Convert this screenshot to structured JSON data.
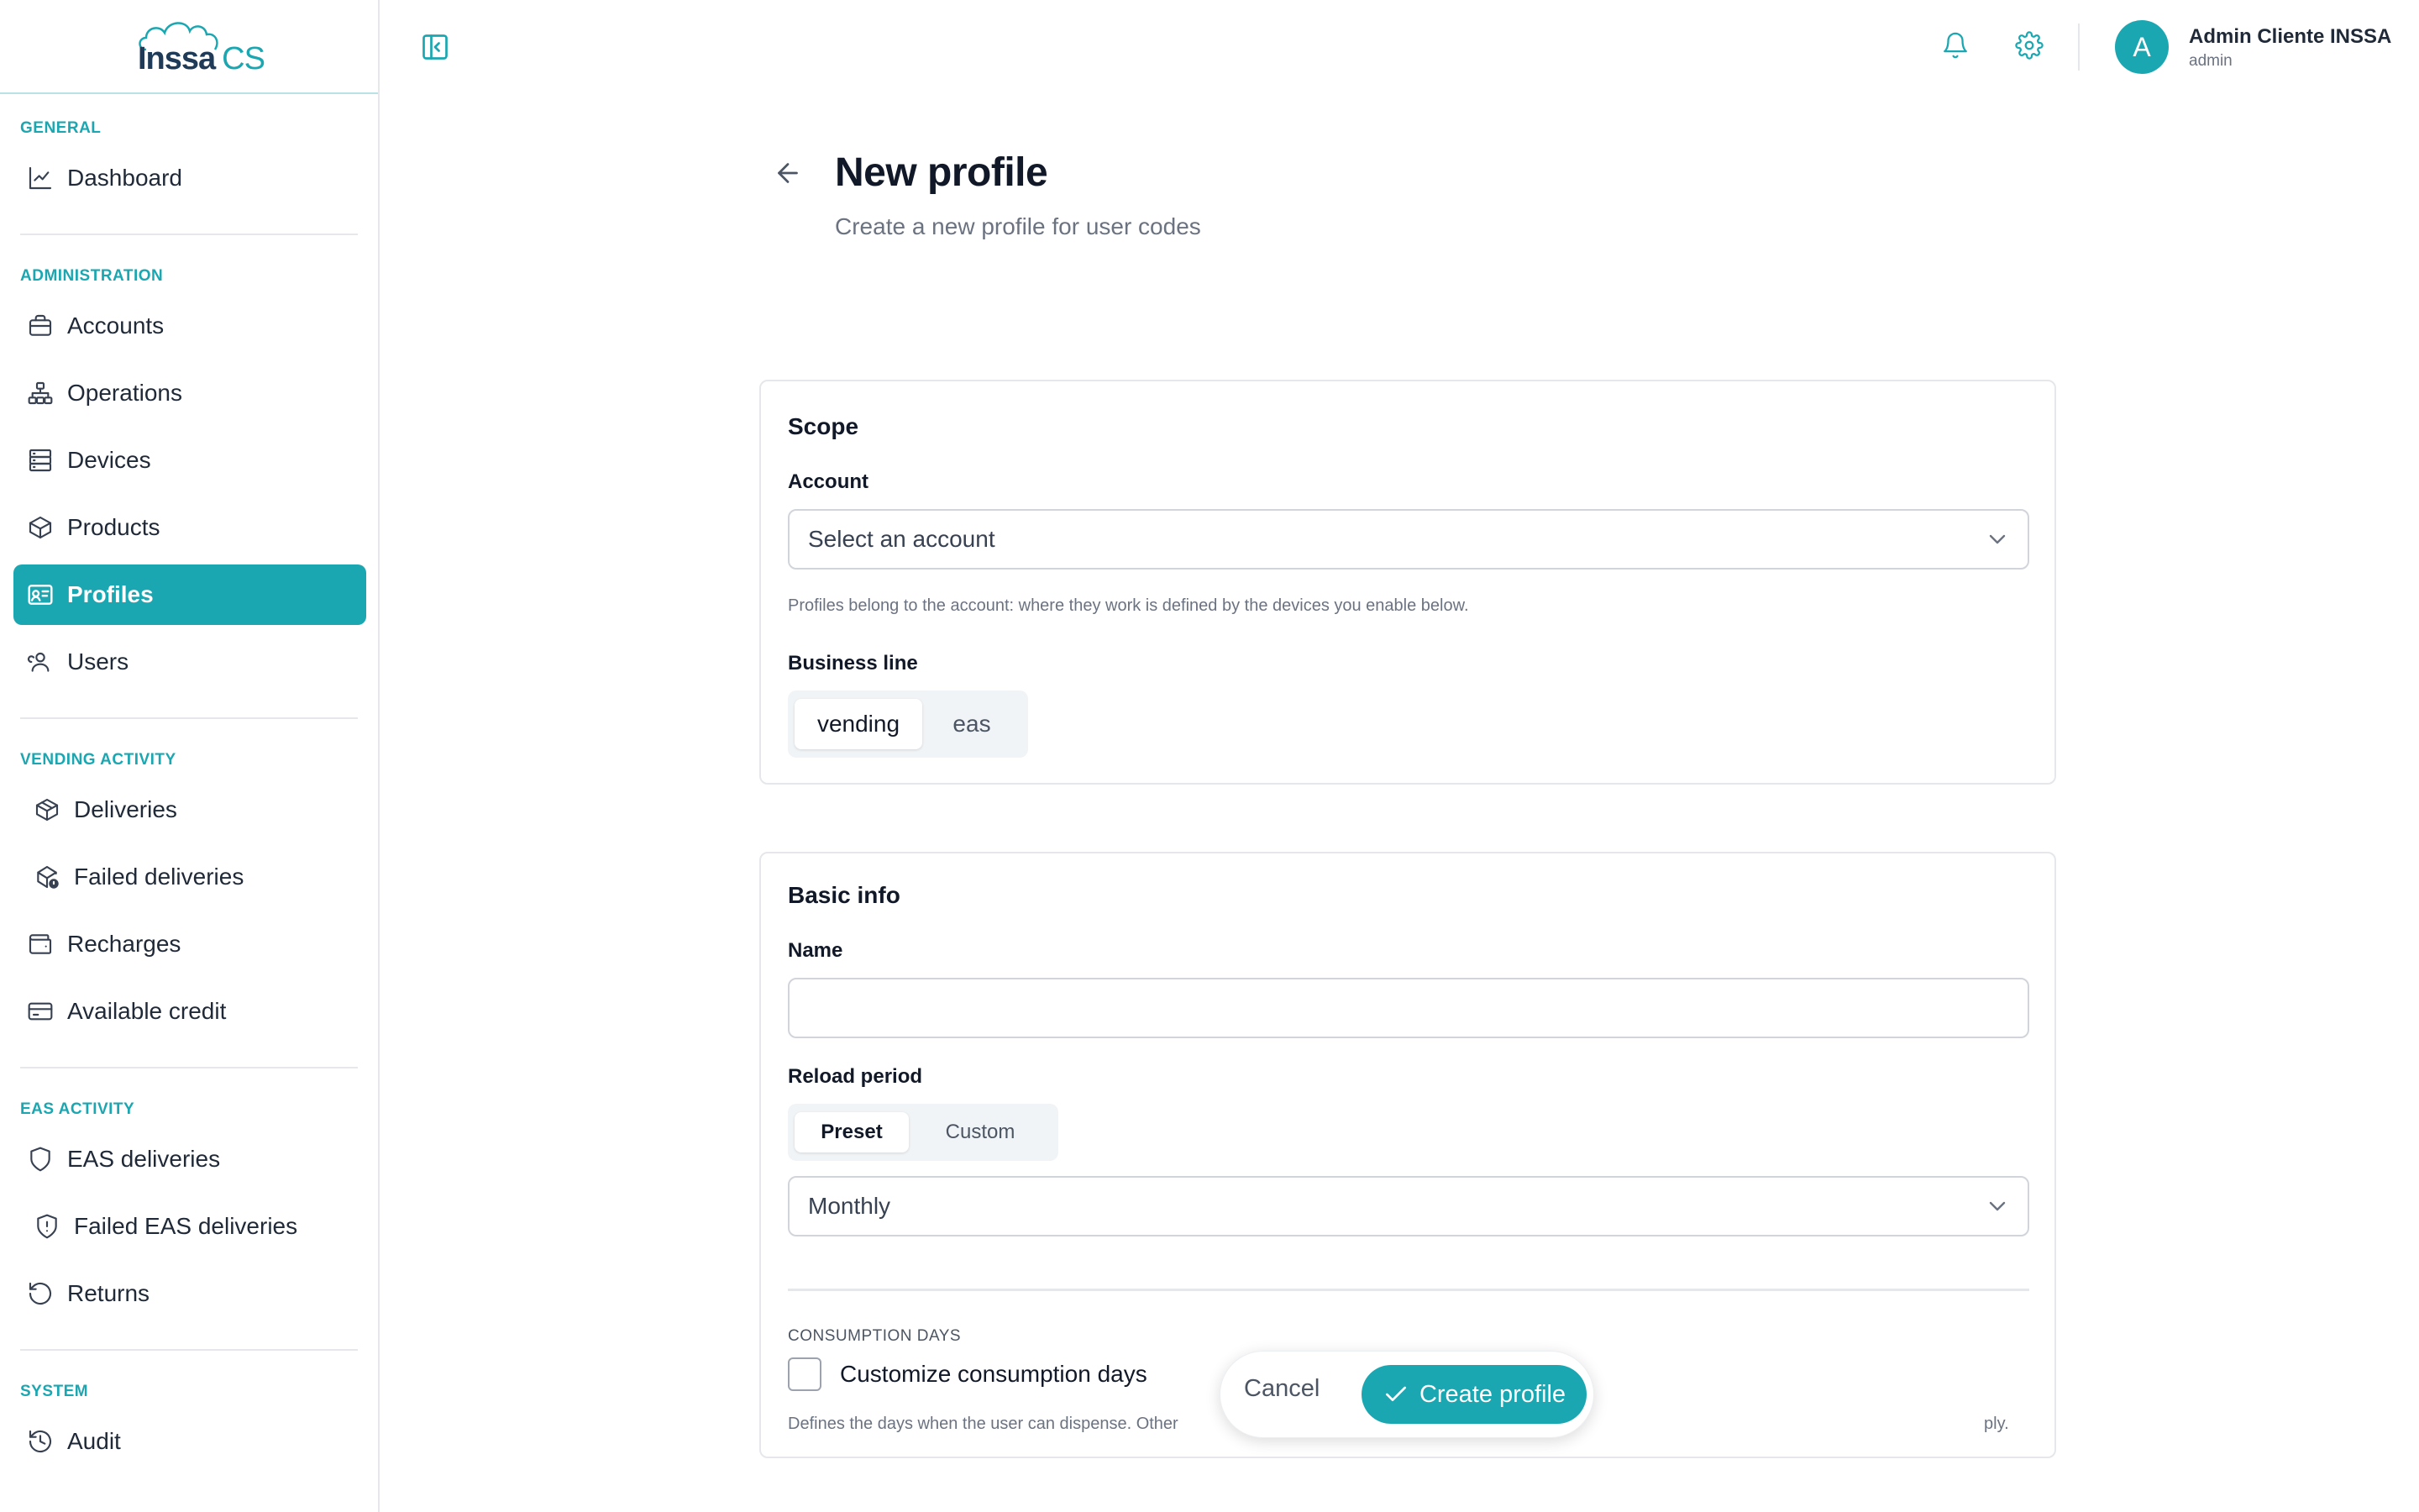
{
  "brand": {
    "logo_text": "Inssa",
    "logo_suffix": "CS",
    "accent": "#1ba7b1"
  },
  "sidebar": {
    "sections": [
      {
        "label": "GENERAL"
      },
      {
        "label": "ADMINISTRATION"
      },
      {
        "label": "VENDING ACTIVITY"
      },
      {
        "label": "EAS ACTIVITY"
      },
      {
        "label": "SYSTEM"
      }
    ],
    "items": [
      {
        "label": "Dashboard",
        "icon": "chart-line-icon"
      },
      {
        "label": "Accounts",
        "icon": "briefcase-icon"
      },
      {
        "label": "Operations",
        "icon": "hierarchy-icon"
      },
      {
        "label": "Devices",
        "icon": "server-icon"
      },
      {
        "label": "Products",
        "icon": "box-icon"
      },
      {
        "label": "Profiles",
        "icon": "id-card-icon",
        "active": true
      },
      {
        "label": "Users",
        "icon": "users-icon"
      },
      {
        "label": "Deliveries",
        "icon": "package-icon"
      },
      {
        "label": "Failed deliveries",
        "icon": "package-alert-icon"
      },
      {
        "label": "Recharges",
        "icon": "wallet-icon"
      },
      {
        "label": "Available credit",
        "icon": "credit-card-icon"
      },
      {
        "label": "EAS deliveries",
        "icon": "shield-icon"
      },
      {
        "label": "Failed EAS deliveries",
        "icon": "shield-alert-icon"
      },
      {
        "label": "Returns",
        "icon": "rotate-ccw-icon"
      },
      {
        "label": "Audit",
        "icon": "history-icon"
      }
    ]
  },
  "header": {
    "user_name": "Admin Cliente INSSA",
    "user_role": "admin",
    "avatar_initial": "A"
  },
  "page": {
    "title": "New profile",
    "subtitle": "Create a new profile for user codes"
  },
  "scope": {
    "title": "Scope",
    "account_label": "Account",
    "account_placeholder": "Select an account",
    "account_help": "Profiles belong to the account: where they work is defined by the devices you enable below.",
    "business_line_label": "Business line",
    "business_lines": [
      "vending",
      "eas"
    ],
    "business_line_selected": "vending"
  },
  "basic_info": {
    "title": "Basic info",
    "name_label": "Name",
    "name_value": "",
    "reload_period_label": "Reload period",
    "reload_modes": [
      "Preset",
      "Custom"
    ],
    "reload_mode_selected": "Preset",
    "reload_period_value": "Monthly",
    "consumption_days_overline": "CONSUMPTION DAYS",
    "customize_label": "Customize consumption days",
    "customize_help_start": "Defines the days when the user can dispense. Other",
    "customize_help_end": "ply."
  },
  "actions": {
    "cancel": "Cancel",
    "create": "Create profile"
  }
}
